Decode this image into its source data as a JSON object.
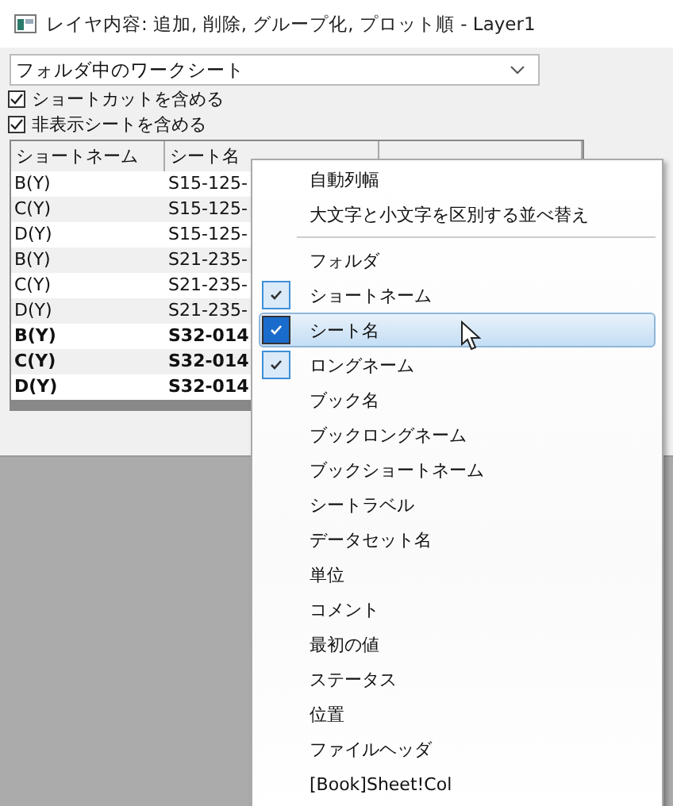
{
  "window": {
    "title": "レイヤ内容: 追加, 削除, グループ化, プロット順 - Layer1"
  },
  "source_dropdown": {
    "value": "フォルダ中のワークシート"
  },
  "options": [
    {
      "label": "ショートカットを含める",
      "checked": true
    },
    {
      "label": "非表示シートを含める",
      "checked": true
    }
  ],
  "table": {
    "columns": [
      "ショートネーム",
      "シート名"
    ],
    "rows": [
      {
        "cells": [
          "B(Y)",
          "S15-125-"
        ],
        "bold": false
      },
      {
        "cells": [
          "C(Y)",
          "S15-125-"
        ],
        "bold": false
      },
      {
        "cells": [
          "D(Y)",
          "S15-125-"
        ],
        "bold": false
      },
      {
        "cells": [
          "B(Y)",
          "S21-235-"
        ],
        "bold": false
      },
      {
        "cells": [
          "C(Y)",
          "S21-235-"
        ],
        "bold": false
      },
      {
        "cells": [
          "D(Y)",
          "S21-235-"
        ],
        "bold": false
      },
      {
        "cells": [
          "B(Y)",
          "S32-014"
        ],
        "bold": true
      },
      {
        "cells": [
          "C(Y)",
          "S32-014"
        ],
        "bold": true
      },
      {
        "cells": [
          "D(Y)",
          "S32-014"
        ],
        "bold": true
      }
    ]
  },
  "context_menu": [
    {
      "kind": "item",
      "label": "自動列幅",
      "checked": false,
      "selected": false
    },
    {
      "kind": "item",
      "label": "大文字と小文字を区別する並べ替え",
      "checked": false,
      "selected": false
    },
    {
      "kind": "separator"
    },
    {
      "kind": "item",
      "label": "フォルダ",
      "checked": false,
      "selected": false
    },
    {
      "kind": "item",
      "label": "ショートネーム",
      "checked": true,
      "selected": false
    },
    {
      "kind": "item",
      "label": "シート名",
      "checked": true,
      "selected": true
    },
    {
      "kind": "item",
      "label": "ロングネーム",
      "checked": true,
      "selected": false
    },
    {
      "kind": "item",
      "label": "ブック名",
      "checked": false,
      "selected": false
    },
    {
      "kind": "item",
      "label": "ブックロングネーム",
      "checked": false,
      "selected": false
    },
    {
      "kind": "item",
      "label": "ブックショートネーム",
      "checked": false,
      "selected": false
    },
    {
      "kind": "item",
      "label": "シートラベル",
      "checked": false,
      "selected": false
    },
    {
      "kind": "item",
      "label": "データセット名",
      "checked": false,
      "selected": false
    },
    {
      "kind": "item",
      "label": "単位",
      "checked": false,
      "selected": false
    },
    {
      "kind": "item",
      "label": "コメント",
      "checked": false,
      "selected": false
    },
    {
      "kind": "item",
      "label": "最初の値",
      "checked": false,
      "selected": false
    },
    {
      "kind": "item",
      "label": "ステータス",
      "checked": false,
      "selected": false
    },
    {
      "kind": "item",
      "label": "位置",
      "checked": false,
      "selected": false
    },
    {
      "kind": "item",
      "label": "ファイルヘッダ",
      "checked": false,
      "selected": false
    },
    {
      "kind": "item",
      "label": "[Book]Sheet!Col",
      "checked": false,
      "selected": false
    }
  ]
}
